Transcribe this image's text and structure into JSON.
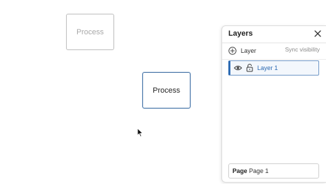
{
  "canvas": {
    "shapes": [
      {
        "label": "Process",
        "state": "faded"
      },
      {
        "label": "Process",
        "state": "selected"
      }
    ]
  },
  "layers_panel": {
    "title": "Layers",
    "add_layer_label": "Layer",
    "sync_label": "Sync visibility",
    "layers": [
      {
        "name": "Layer 1",
        "visible": true,
        "locked": false,
        "selected": true
      }
    ],
    "page": {
      "label": "Page",
      "value": "Page 1"
    }
  },
  "icons": {
    "close": "close-icon",
    "add": "plus-circle-icon",
    "visibility": "eye-icon",
    "lock": "lock-icon",
    "cursor": "mouse-pointer-icon"
  },
  "colors": {
    "accent": "#2d6bb3",
    "selected_border": "#3f6fa3",
    "faded_text": "#a8a8a8"
  }
}
